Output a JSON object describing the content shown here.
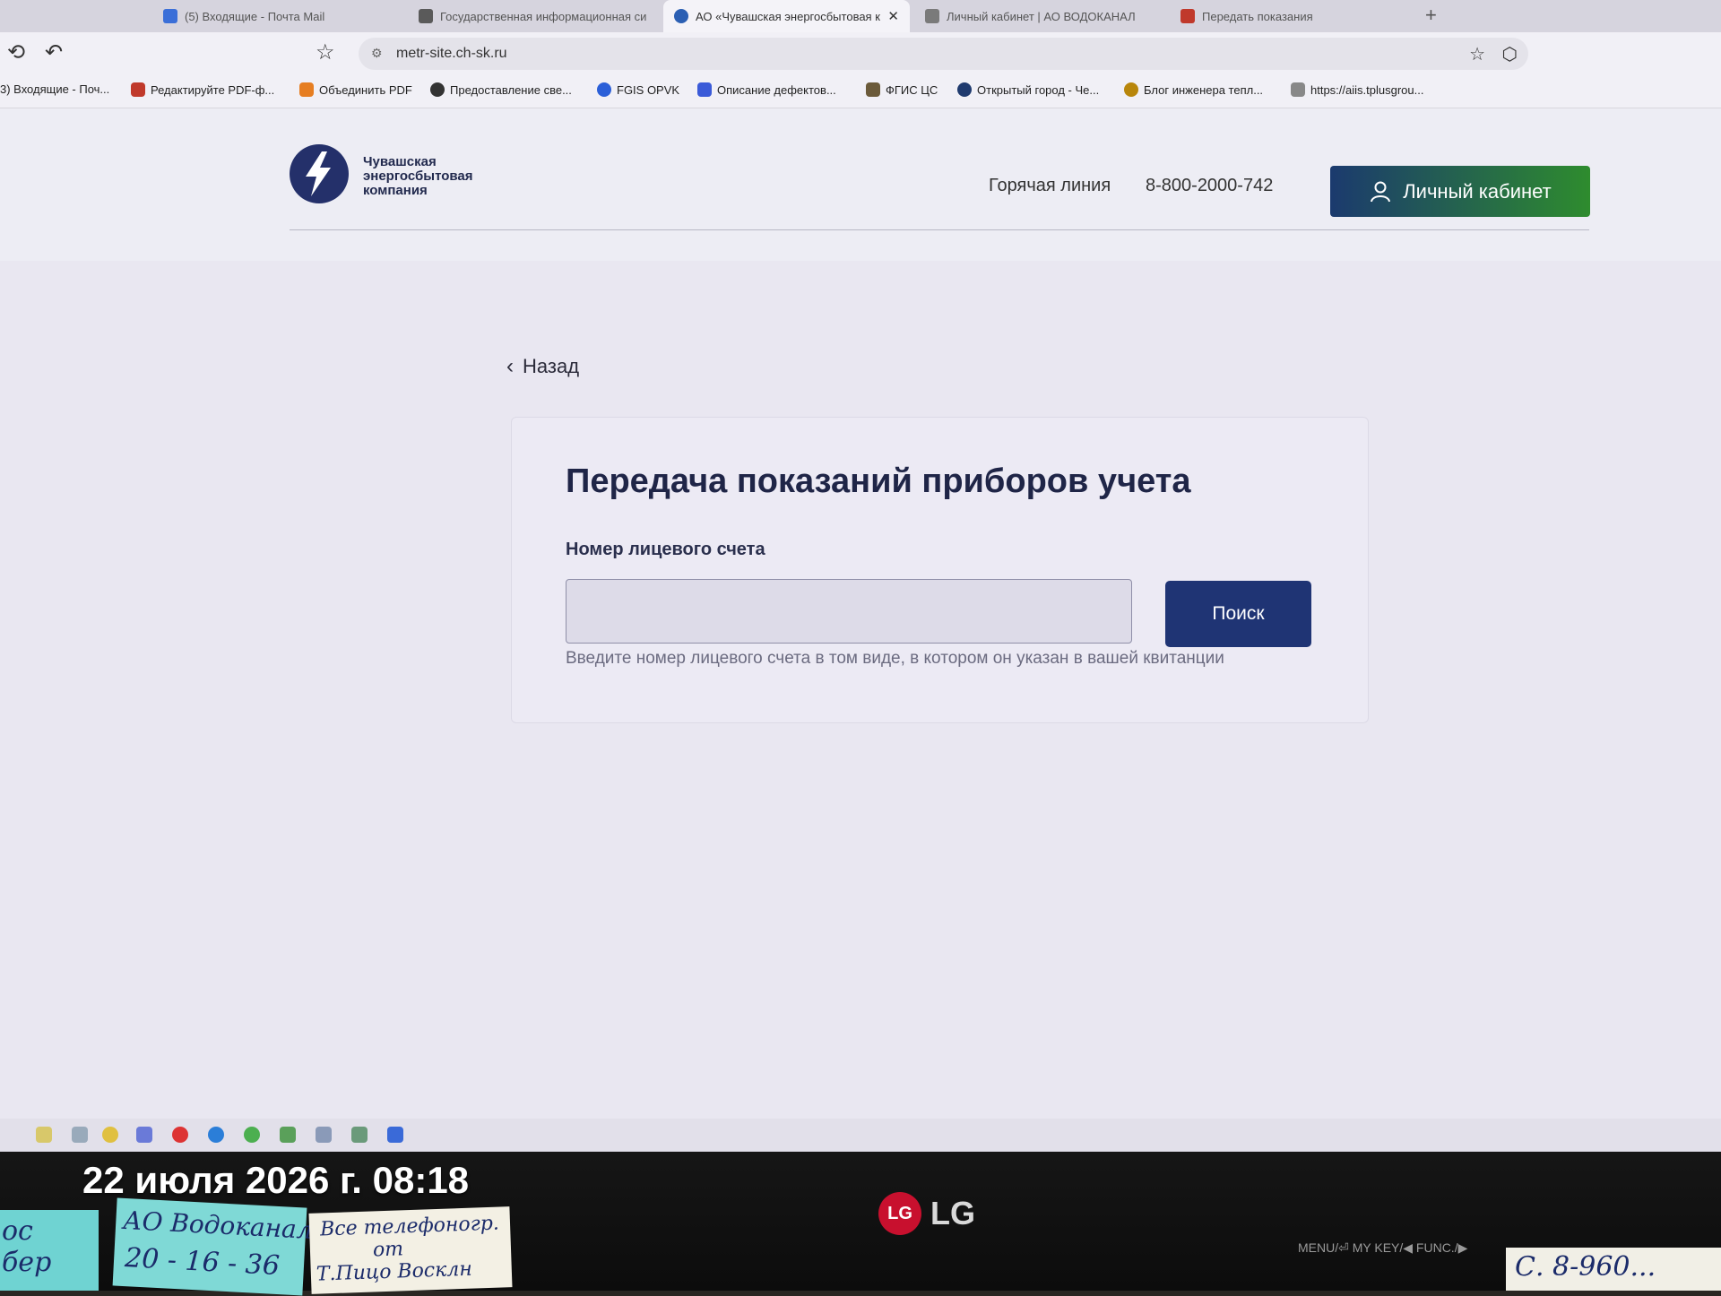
{
  "browser": {
    "tabs": [
      {
        "title": "(5) Входящие - Почта Mail",
        "active": false
      },
      {
        "title": "Государственная информационная си",
        "active": false
      },
      {
        "title": "АО «Чувашская энергосбытовая к",
        "active": true
      },
      {
        "title": "Личный кабинет | АО ВОДОКАНАЛ",
        "active": false
      },
      {
        "title": "Передать показания",
        "active": false
      }
    ],
    "new_tab": "+",
    "url": "metr-site.ch-sk.ru",
    "bookmarks": [
      "3) Входящие - Поч...",
      "Редактируйте PDF-ф...",
      "Объединить PDF",
      "Предоставление све...",
      "FGIS OPVK",
      "Описание дефектов...",
      "ФГИС ЦС",
      "Открытый город - Че...",
      "Блог инженера тепл...",
      "https://aiis.tplusgrou..."
    ]
  },
  "site": {
    "logo_lines": [
      "Чувашская",
      "энергосбытовая",
      "компания"
    ],
    "hotline_label": "Горячая линия",
    "hotline_phone": "8-800-2000-742",
    "cabinet_label": "Личный кабинет",
    "back_label": "Назад",
    "form": {
      "title": "Передача показаний приборов учета",
      "field_label": "Номер лицевого счета",
      "field_value": "",
      "button_label": "Поиск",
      "hint": "Введите номер лицевого счета в том виде, в котором он указан в вашей квитанции"
    }
  },
  "photo": {
    "datestamp": "22 июля 2026 г. 08:18",
    "monitor_brand": "LG",
    "bezel_keys": "MENU/⏎   MY KEY/◀   FUNC./▶",
    "notes": {
      "n1": [
        "ос",
        "бер"
      ],
      "n2": [
        "АО Водоканал",
        "20 - 16 - 36"
      ],
      "n3": [
        "Все телефоногр.",
        "от",
        "Т.Пицо Восклн"
      ],
      "n4": [
        "С. 8-960..."
      ]
    }
  },
  "colors": {
    "brand_navy": "#1f3474",
    "cabinet_gradient_start": "#1b3a6e",
    "cabinet_gradient_end": "#2e8c2e",
    "page_bg": "#e9e7f1"
  }
}
